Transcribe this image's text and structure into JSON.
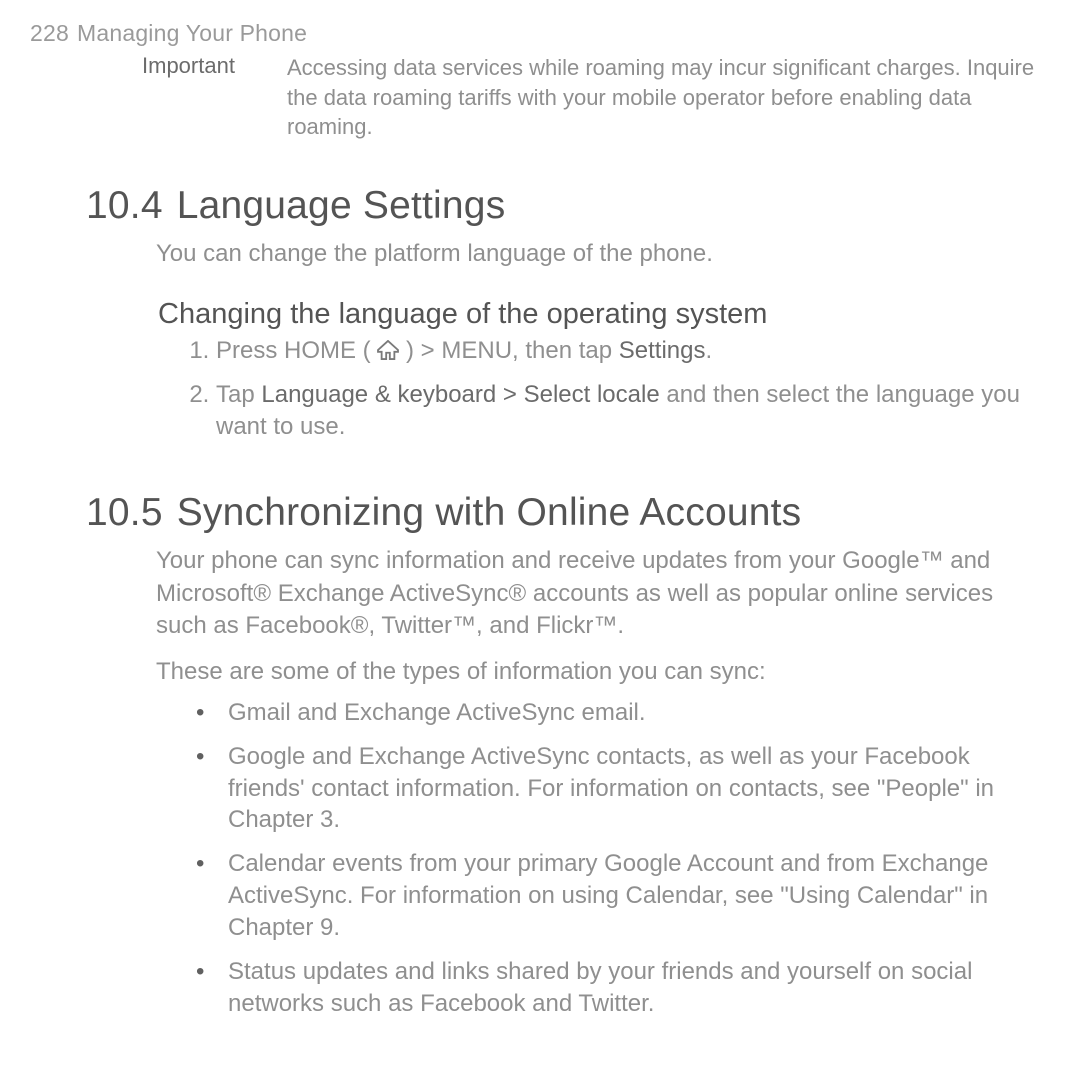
{
  "header": {
    "page_number": "228",
    "title": "Managing Your Phone"
  },
  "note": {
    "label": "Important",
    "text": "Accessing data services while roaming may incur significant charges. Inquire the data roaming tariffs with your mobile operator before enabling data roaming."
  },
  "sec1": {
    "number": "10.4",
    "title": "Language Settings",
    "intro": "You can change the platform language of the phone.",
    "subhead": "Changing the language of the operating system",
    "step1_a": "Press HOME ( ",
    "step1_b": " ) > MENU, then tap ",
    "step1_c": "Settings",
    "step1_d": ".",
    "step2_a": "Tap ",
    "step2_b": "Language & keyboard > Select locale",
    "step2_c": " and then select the language you want to use."
  },
  "sec2": {
    "number": "10.5",
    "title": "Synchronizing with Online Accounts",
    "intro1": "Your phone can sync information and receive updates from your Google™ and Microsoft® Exchange ActiveSync® accounts as well as popular online services such as Facebook®, Twitter™, and Flickr™.",
    "intro2": "These are some of the types of information you can sync:",
    "bullets": {
      "b0": "Gmail and Exchange ActiveSync email.",
      "b1": "Google and Exchange ActiveSync contacts, as well as your Facebook friends' contact information. For information on contacts, see \"People\" in Chapter 3.",
      "b2": "Calendar events from your primary Google Account and from Exchange ActiveSync. For information on using Calendar, see \"Using Calendar\" in Chapter 9.",
      "b3": "Status updates and links shared by your friends and yourself on social networks such as Facebook and Twitter."
    }
  }
}
